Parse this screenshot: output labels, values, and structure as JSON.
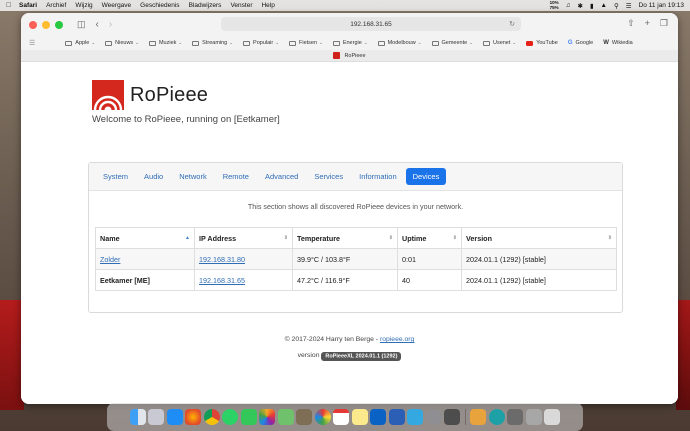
{
  "menubar": {
    "items": [
      "Safari",
      "Archief",
      "Wijzig",
      "Weergave",
      "Geschiedenis",
      "Bladwijzers",
      "Venster",
      "Help"
    ],
    "status_top": "10%",
    "status_bottom": "75%",
    "clock": "Do 11 jan  19:13"
  },
  "browser": {
    "url": "192.168.31.65",
    "favorites": [
      {
        "label": "Apple",
        "kind": "folder"
      },
      {
        "label": "Nieuws",
        "kind": "folder"
      },
      {
        "label": "Muziek",
        "kind": "folder"
      },
      {
        "label": "Streaming",
        "kind": "folder"
      },
      {
        "label": "Populair",
        "kind": "folder"
      },
      {
        "label": "Fietsen",
        "kind": "folder"
      },
      {
        "label": "Energie",
        "kind": "folder"
      },
      {
        "label": "Modelbouw",
        "kind": "folder"
      },
      {
        "label": "Gemeente",
        "kind": "folder"
      },
      {
        "label": "Usenet",
        "kind": "folder"
      },
      {
        "label": "YouTube",
        "kind": "youtube"
      },
      {
        "label": "Google",
        "kind": "google"
      },
      {
        "label": "Wikiedia",
        "kind": "wiki"
      }
    ],
    "tab_title": "RoPieee"
  },
  "page": {
    "brand": "RoPieee",
    "welcome": "Welcome to RoPieee, running on [Eetkamer]",
    "tabs": [
      "System",
      "Audio",
      "Network",
      "Remote",
      "Advanced",
      "Services",
      "Information",
      "Devices"
    ],
    "active_tab": "Devices",
    "info": "This section shows all discovered RoPieee devices in your network.",
    "table": {
      "headers": [
        "Name",
        "IP Address",
        "Temperature",
        "Uptime",
        "Version"
      ],
      "rows": [
        {
          "name": "Zolder",
          "ip": "192.168.31.80",
          "temp": "39.9°C / 103.8°F",
          "uptime": "0:01",
          "version": "2024.01.1 (1292)  [stable]"
        },
        {
          "name": "Eetkamer [ME]",
          "ip": "192.168.31.65",
          "temp": "47.2°C / 116.9°F",
          "uptime": "40",
          "version": "2024.01.1 (1292)  [stable]"
        }
      ]
    },
    "footer": {
      "copyright": "© 2017-2024 Harry ten Berge - ",
      "link": "ropieee.org",
      "version_label": "version",
      "version_badge": "RoPieeeXL 2024.01.1 (1292)"
    }
  },
  "colors": {
    "accent": "#1a73e8",
    "link": "#2f6db5",
    "brand_red": "#d4281f"
  },
  "dock_icons": [
    "finder-icon",
    "launchpad-icon",
    "app-store-icon",
    "firefox-icon",
    "chrome-icon",
    "whatsapp-icon",
    "messages-icon",
    "photos-icon",
    "maps-icon",
    "gimp-icon",
    "system-icon",
    "calendar-icon",
    "notes-icon",
    "outlook-icon",
    "word-icon",
    "app-icon",
    "settings-icon",
    "preview-icon",
    "bambu-icon",
    "edge-icon",
    "finder-docs-icon",
    "downloads-icon",
    "trash-icon"
  ]
}
